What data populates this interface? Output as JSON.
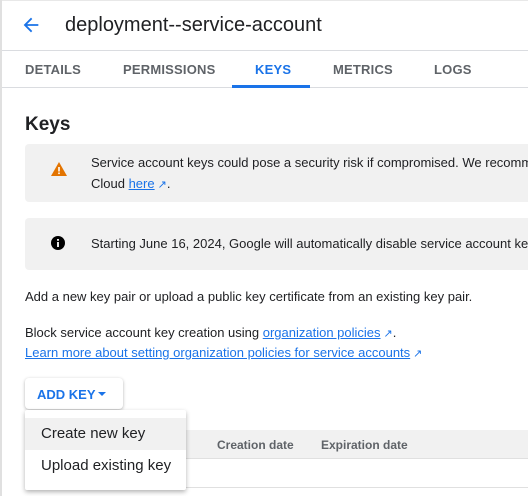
{
  "header": {
    "title": "deployment--service-account",
    "back_icon": "arrow-left-icon"
  },
  "tabs": [
    {
      "label": "DETAILS"
    },
    {
      "label": "PERMISSIONS"
    },
    {
      "label": "KEYS",
      "active": true
    },
    {
      "label": "METRICS"
    },
    {
      "label": "LOGS"
    }
  ],
  "section_title": "Keys",
  "warning": {
    "text": "Service account keys could pose a security risk if compromised. We recomm",
    "line2_prefix": "Cloud ",
    "link": "here",
    "suffix": "."
  },
  "info": {
    "text": "Starting June 16, 2024, Google will automatically disable service account ke"
  },
  "description": "Add a new key pair or upload a public key certificate from an existing key pair.",
  "block": {
    "prefix": "Block service account key creation using ",
    "link": "organization policies",
    "suffix": "."
  },
  "learn_more": "Learn more about setting organization policies for service accounts",
  "add_key": {
    "label": "ADD KEY"
  },
  "menu": [
    {
      "label": "Create new key"
    },
    {
      "label": "Upload existing key"
    }
  ],
  "table": {
    "columns": [
      "Creation date",
      "Expiration date"
    ]
  },
  "colors": {
    "accent": "#1a73e8",
    "warning": "#e37400"
  }
}
